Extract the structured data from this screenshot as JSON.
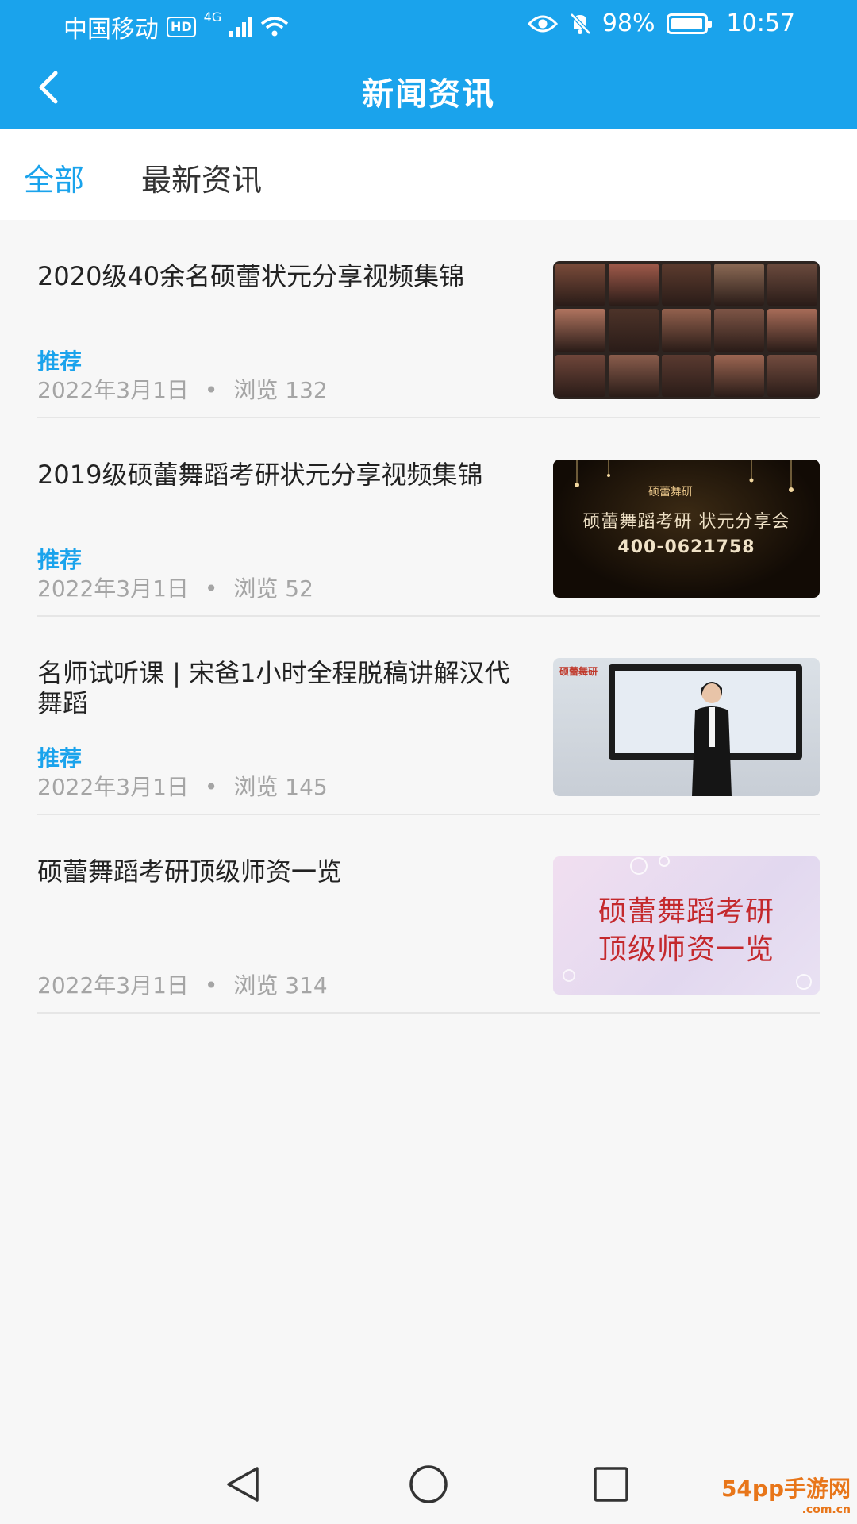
{
  "status_bar": {
    "carrier": "中国移动",
    "hd": "HD",
    "network": "4G",
    "battery": "98%",
    "battery_level": 0.98,
    "time": "10:57"
  },
  "header": {
    "title": "新闻资讯"
  },
  "tabs": [
    {
      "label": "全部",
      "active": true
    },
    {
      "label": "最新资讯",
      "active": false
    }
  ],
  "news": [
    {
      "title": "2020级40余名硕蕾状元分享视频集锦",
      "tag": "推荐",
      "date": "2022年3月1日",
      "views": "浏览 132"
    },
    {
      "title": "2019级硕蕾舞蹈考研状元分享视频集锦",
      "tag": "推荐",
      "date": "2022年3月1日",
      "views": "浏览 52",
      "thumb_text": {
        "logo": "硕蕾舞研",
        "line1": "硕蕾舞蹈考研  状元分享会",
        "line2": "400-0621758"
      }
    },
    {
      "title": "名师试听课 | 宋爸1小时全程脱稿讲解汉代舞蹈",
      "tag": "推荐",
      "date": "2022年3月1日",
      "views": "浏览 145",
      "thumb_text": {
        "logo": "硕蕾舞研"
      }
    },
    {
      "title": "硕蕾舞蹈考研顶级师资一览",
      "tag": "",
      "date": "2022年3月1日",
      "views": "浏览 314",
      "thumb_text": {
        "line1": "硕蕾舞蹈考研",
        "line2": "顶级师资一览"
      }
    }
  ],
  "separator": "•",
  "watermark": {
    "main": "54pp手游网",
    "sub": ".com.cn"
  },
  "colors": {
    "accent": "#1aa3ec",
    "meta": "#a5a5a5"
  },
  "icons": {
    "back": "back-arrow-icon",
    "nav_back": "triangle-back-icon",
    "nav_home": "circle-home-icon",
    "nav_recent": "square-recent-icon"
  }
}
